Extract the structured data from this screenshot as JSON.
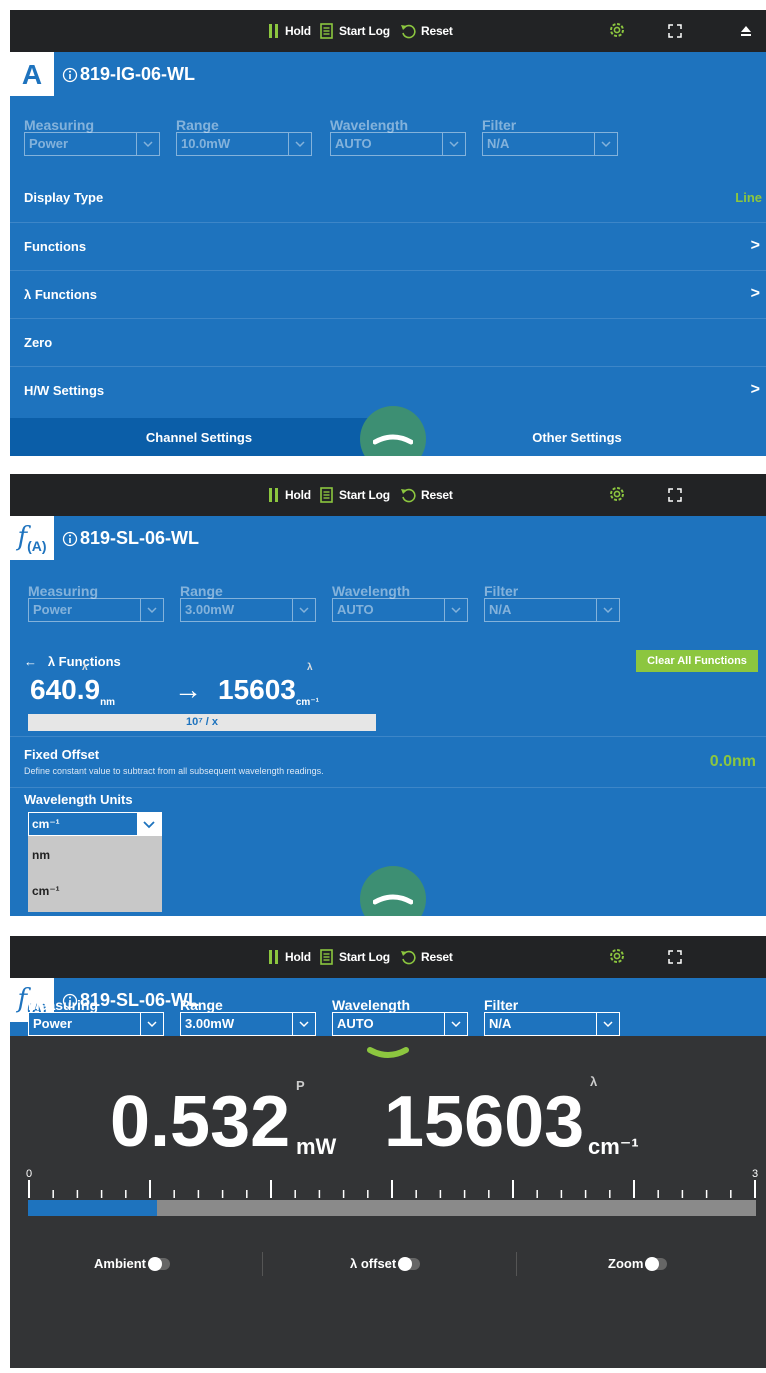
{
  "topbar": {
    "hold": "Hold",
    "start_log": "Start Log",
    "reset": "Reset"
  },
  "colors": {
    "blue": "#1e73be",
    "dark_blue": "#0b5ea8",
    "green": "#8cc63f",
    "teal": "#3d8f73",
    "topbar": "#222325",
    "meter_bg": "#333436"
  },
  "panel1": {
    "badge": "A",
    "device": "819-IG-06-WL",
    "selects": [
      {
        "label": "Measuring",
        "value": "Power"
      },
      {
        "label": "Range",
        "value": "10.0mW"
      },
      {
        "label": "Wavelength",
        "value": "AUTO"
      },
      {
        "label": "Filter",
        "value": "N/A"
      }
    ],
    "rows": [
      {
        "label": "Display Type",
        "value": "Line"
      },
      {
        "label": "Functions",
        "chevron": ">"
      },
      {
        "label": "λ Functions",
        "chevron": ">"
      },
      {
        "label": "Zero"
      },
      {
        "label": "H/W Settings",
        "chevron": ">"
      }
    ],
    "tabs": {
      "channel": "Channel Settings",
      "other": "Other Settings"
    }
  },
  "panel2": {
    "badge_f": "f",
    "badge_sub": "(A)",
    "device": "819-SL-06-WL",
    "selects": [
      {
        "label": "Measuring",
        "value": "Power"
      },
      {
        "label": "Range",
        "value": "3.00mW"
      },
      {
        "label": "Wavelength",
        "value": "AUTO"
      },
      {
        "label": "Filter",
        "value": "N/A"
      }
    ],
    "back_arrow": "←",
    "functions_title": "λ Functions",
    "clear_all": "Clear All Functions",
    "input_value": "640.9",
    "input_unit": "nm",
    "input_sup": "λ",
    "arrow": "→",
    "output_value": "15603",
    "output_unit": "cm⁻¹",
    "output_sup": "λ",
    "formula": "10⁷ / x",
    "fixed_offset_title": "Fixed Offset",
    "fixed_offset_desc": "Define constant value to subtract from all subsequent wavelength readings.",
    "fixed_offset_value": "0.0nm",
    "wavelength_units_label": "Wavelength Units",
    "wavelength_units_value": "cm⁻¹",
    "wavelength_units_options": [
      "nm",
      "cm⁻¹"
    ]
  },
  "panel3": {
    "badge_f": "f",
    "badge_sub": "(A)",
    "device": "819-SL-06-WL",
    "selects": [
      {
        "label": "Measuring",
        "value": "Power"
      },
      {
        "label": "Range",
        "value": "3.00mW"
      },
      {
        "label": "Wavelength",
        "value": "AUTO"
      },
      {
        "label": "Filter",
        "value": "N/A"
      }
    ],
    "power_value": "0.532",
    "power_unit": "mW",
    "power_sup": "P",
    "wl_value": "15603",
    "wl_unit": "cm⁻¹",
    "wl_sup": "λ",
    "scale_min": "0",
    "scale_max": "3",
    "bar_fraction": 0.177,
    "toggles": {
      "ambient": "Ambient",
      "offset": "λ offset",
      "zoom": "Zoom"
    }
  }
}
